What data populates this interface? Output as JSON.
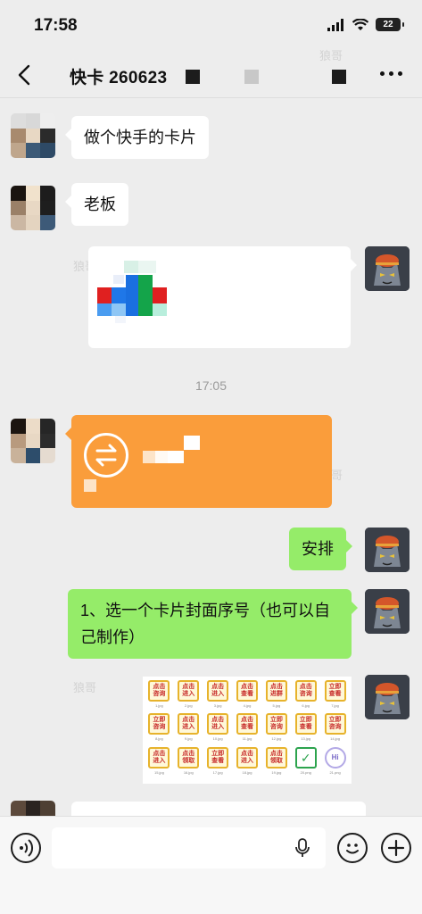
{
  "status_bar": {
    "time": "17:58",
    "battery": "22"
  },
  "nav": {
    "title": "快卡 260623"
  },
  "watermark": "狼哥",
  "timestamp": "17:05",
  "messages": {
    "m1": "做个快手的卡片",
    "m2": "老板",
    "m3": "安排",
    "m4": "1、选一个卡片封面序号（也可以自己制作）"
  },
  "thumbnails": [
    {
      "text": "点击咨询",
      "cap": "1.jpg"
    },
    {
      "text": "点击进入",
      "cap": "2.jpg"
    },
    {
      "text": "点击进入",
      "cap": "3.jpg"
    },
    {
      "text": "点击查看",
      "cap": "4.jpg"
    },
    {
      "text": "点击进群",
      "cap": "5.jpg"
    },
    {
      "text": "点击咨询",
      "cap": "6.jpg"
    },
    {
      "text": "立即查看",
      "cap": "7.jpg"
    },
    {
      "text": "立即咨询",
      "cap": "8.jpg"
    },
    {
      "text": "点击进入",
      "cap": "9.jpg"
    },
    {
      "text": "点击进入",
      "cap": "10.jpg"
    },
    {
      "text": "点击查看",
      "cap": "11.jpg"
    },
    {
      "text": "立即咨询",
      "cap": "12.jpg"
    },
    {
      "text": "立即查看",
      "cap": "13.jpg"
    },
    {
      "text": "立即咨询",
      "cap": "14.jpg"
    },
    {
      "text": "点击进入",
      "cap": "15.jpg"
    },
    {
      "text": "点击领取",
      "cap": "16.jpg"
    },
    {
      "text": "立即查看",
      "cap": "17.jpg"
    },
    {
      "text": "点击进入",
      "cap": "18.jpg"
    },
    {
      "text": "点击领取",
      "cap": "19.jpg"
    },
    {
      "text": "✓",
      "cap": "20.png"
    },
    {
      "text": "Hi",
      "cap": "21.png"
    }
  ]
}
